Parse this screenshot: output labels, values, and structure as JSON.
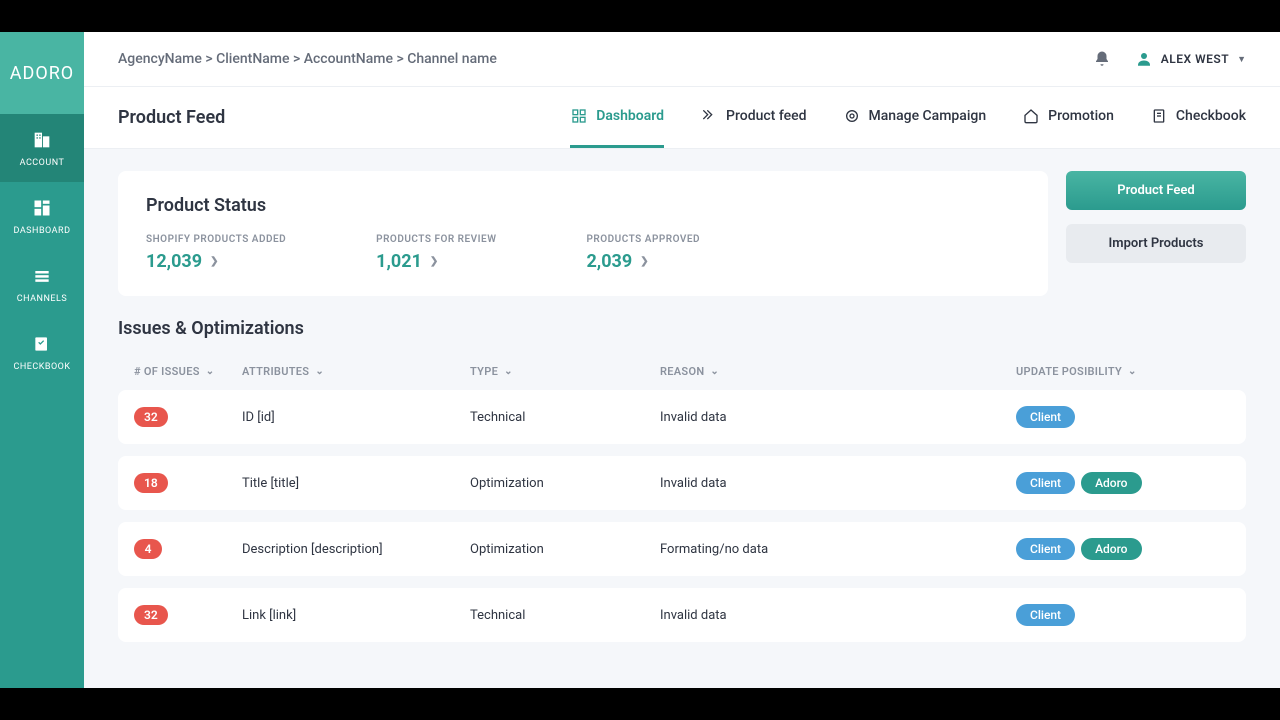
{
  "brand": "ADORO",
  "sidebar": {
    "items": [
      {
        "label": "ACCOUNT"
      },
      {
        "label": "DASHBOARD"
      },
      {
        "label": "CHANNELS"
      },
      {
        "label": "CHECKBOOK"
      }
    ]
  },
  "breadcrumb": "AgencyName > ClientName > AccountName > Channel name",
  "user": {
    "name": "ALEX WEST"
  },
  "page_title": "Product Feed",
  "tabs": [
    {
      "label": "Dashboard"
    },
    {
      "label": "Product feed"
    },
    {
      "label": "Manage Campaign"
    },
    {
      "label": "Promotion"
    },
    {
      "label": "Checkbook"
    }
  ],
  "status": {
    "title": "Product Status",
    "metrics": [
      {
        "label": "SHOPIFY PRODUCTS ADDED",
        "value": "12,039"
      },
      {
        "label": "PRODUCTS FOR REVIEW",
        "value": "1,021"
      },
      {
        "label": "PRODUCTS APPROVED",
        "value": "2,039"
      }
    ]
  },
  "actions": {
    "primary": "Product Feed",
    "secondary": "Import Products"
  },
  "issues": {
    "title": "Issues & Optimizations",
    "columns": {
      "issues": "# OF ISSUES",
      "attributes": "ATTRIBUTES",
      "type": "TYPE",
      "reason": "REASON",
      "update": "UPDATE POSIBILITY"
    },
    "rows": [
      {
        "count": "32",
        "attr": "ID [id]",
        "type": "Technical",
        "reason": "Invalid data",
        "pills": [
          "Client"
        ]
      },
      {
        "count": "18",
        "attr": "Title [title]",
        "type": "Optimization",
        "reason": "Invalid data",
        "pills": [
          "Client",
          "Adoro"
        ]
      },
      {
        "count": "4",
        "attr": "Description [description]",
        "type": "Optimization",
        "reason": "Formating/no data",
        "pills": [
          "Client",
          "Adoro"
        ]
      },
      {
        "count": "32",
        "attr": "Link [link]",
        "type": "Technical",
        "reason": "Invalid data",
        "pills": [
          "Client"
        ]
      }
    ]
  }
}
